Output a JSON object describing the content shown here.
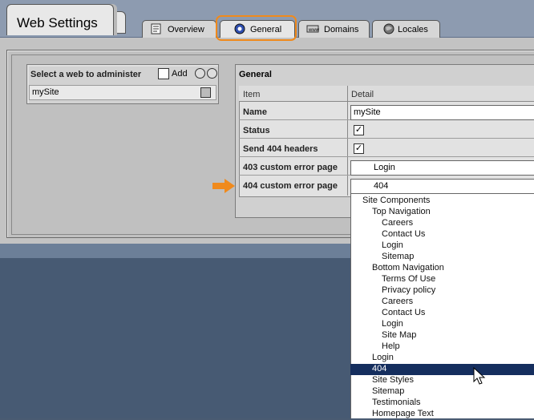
{
  "app": {
    "title": "Web Settings"
  },
  "tabs": [
    {
      "label": "Overview",
      "icon": "overview-icon",
      "active": false
    },
    {
      "label": "General",
      "icon": "general-icon",
      "active": true
    },
    {
      "label": "Domains",
      "icon": "domains-icon",
      "active": false
    },
    {
      "label": "Locales",
      "icon": "globe-icon",
      "active": false
    }
  ],
  "left_panel": {
    "heading": "Select a web to administer",
    "add_label": "Add",
    "items": [
      {
        "label": "mySite"
      }
    ]
  },
  "general": {
    "heading": "General",
    "columns": [
      "Item",
      "Detail"
    ],
    "rows": {
      "name": {
        "label": "Name",
        "value": "mySite"
      },
      "status": {
        "label": "Status",
        "checked": true
      },
      "send404": {
        "label": "Send 404 headers",
        "checked": true
      },
      "err403": {
        "label": "403 custom error page",
        "value": "Login"
      },
      "err404": {
        "label": "404 custom error page",
        "value": "404"
      }
    }
  },
  "dropdown": {
    "items": [
      {
        "label": "Site Components",
        "level": 0
      },
      {
        "label": "Top Navigation",
        "level": 1
      },
      {
        "label": "Careers",
        "level": 2
      },
      {
        "label": "Contact Us",
        "level": 2
      },
      {
        "label": "Login",
        "level": 2
      },
      {
        "label": "Sitemap",
        "level": 2
      },
      {
        "label": "Bottom Navigation",
        "level": 1
      },
      {
        "label": "Terms Of Use",
        "level": 2
      },
      {
        "label": "Privacy policy",
        "level": 2
      },
      {
        "label": "Careers",
        "level": 2
      },
      {
        "label": "Contact Us",
        "level": 2
      },
      {
        "label": "Login",
        "level": 2
      },
      {
        "label": "Site Map",
        "level": 2
      },
      {
        "label": "Help",
        "level": 2
      },
      {
        "label": "Login",
        "level": 1
      },
      {
        "label": "404",
        "level": 1,
        "selected": true
      },
      {
        "label": "Site Styles",
        "level": 1
      },
      {
        "label": "Sitemap",
        "level": 1
      },
      {
        "label": "Testimonials",
        "level": 1
      },
      {
        "label": "Homepage Text",
        "level": 1
      }
    ]
  },
  "colors": {
    "highlight": "#f08a1c",
    "selection": "#152e5e",
    "background": "#4a5b72"
  }
}
